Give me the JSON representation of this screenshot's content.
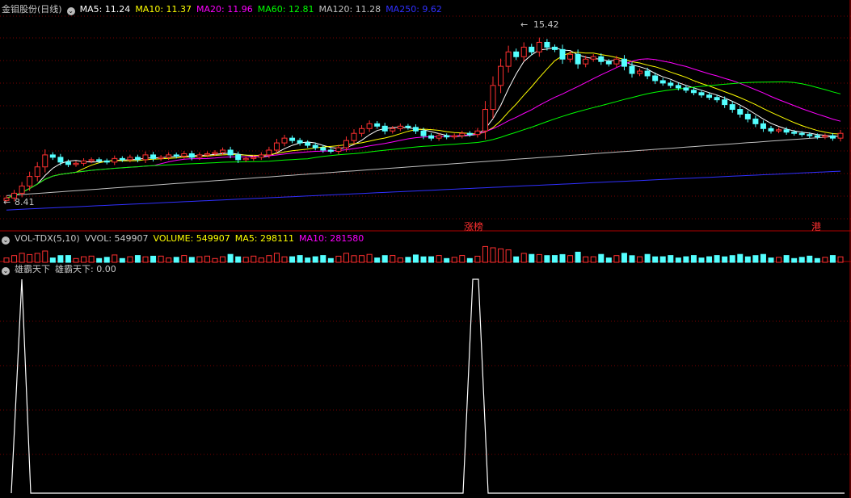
{
  "header": {
    "stock_name": "金钼股份(日线)",
    "ma5": "MA5: 11.24",
    "ma10": "MA10: 11.37",
    "ma20": "MA20: 11.96",
    "ma60": "MA60: 12.81",
    "ma120": "MA120: 11.28",
    "ma250": "MA250: 9.62"
  },
  "price_labels": {
    "high": "15.42",
    "low": "8.41"
  },
  "markers": {
    "zhangting": "涨榜",
    "gang": "港"
  },
  "vol_header": {
    "title": "VOL-TDX(5,10)",
    "vvol": "VVOL: 549907",
    "volume": "VOLUME: 549907",
    "ma5": "MA5: 298111",
    "ma10": "MA10: 281580"
  },
  "indicator_header": {
    "title": "雄霸天下",
    "value": "雄霸天下: 0.00"
  },
  "colors": {
    "ma5": "#ffffff",
    "ma10": "#ffff00",
    "ma20": "#ff00ff",
    "ma60": "#00ff00",
    "ma120": "#c0c0c0",
    "ma250": "#3030ff",
    "up": "#ff3030",
    "down": "#54ffff",
    "grid": "#7a0000"
  },
  "chart_data": {
    "type": "candlestick",
    "price_high": 15.42,
    "price_low": 8.41,
    "closes": [
      8.5,
      8.7,
      9.0,
      9.4,
      9.8,
      10.3,
      10.2,
      10.0,
      9.9,
      9.95,
      10.05,
      10.1,
      10.05,
      10.0,
      10.15,
      10.1,
      10.2,
      10.1,
      10.3,
      10.15,
      10.2,
      10.3,
      10.25,
      10.35,
      10.2,
      10.3,
      10.35,
      10.4,
      10.5,
      10.3,
      10.1,
      10.15,
      10.2,
      10.3,
      10.5,
      10.8,
      11.0,
      10.9,
      10.8,
      10.7,
      10.6,
      10.5,
      10.45,
      10.6,
      10.9,
      11.2,
      11.4,
      11.6,
      11.5,
      11.3,
      11.4,
      11.5,
      11.45,
      11.3,
      11.1,
      11.0,
      11.1,
      11.05,
      11.1,
      11.2,
      11.15,
      11.3,
      12.2,
      13.2,
      14.0,
      14.6,
      14.4,
      14.8,
      14.6,
      15.0,
      14.8,
      14.7,
      14.3,
      14.5,
      14.1,
      14.3,
      14.4,
      14.2,
      14.1,
      14.3,
      14.0,
      13.7,
      13.8,
      13.6,
      13.4,
      13.3,
      13.2,
      13.1,
      13.0,
      12.9,
      12.8,
      12.7,
      12.6,
      12.4,
      12.2,
      12.0,
      11.8,
      11.6,
      11.4,
      11.3,
      11.35,
      11.25,
      11.2,
      11.15,
      11.1,
      11.05,
      11.1,
      11.0,
      11.2
    ],
    "indicator": {
      "type": "line",
      "peaks": [
        {
          "position": "start",
          "value": 1
        },
        {
          "position": "middle",
          "value": 1
        }
      ],
      "baseline": 0
    }
  }
}
